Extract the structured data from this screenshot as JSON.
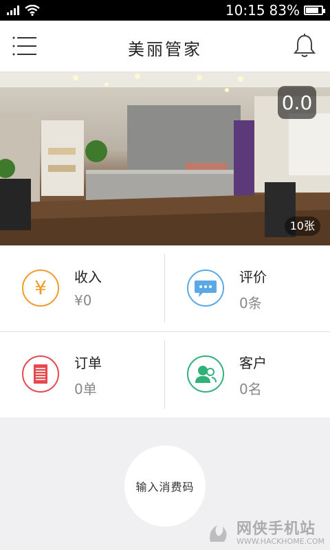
{
  "status_bar": {
    "time": "10:15",
    "battery": "83%",
    "battery_level": 0.83
  },
  "header": {
    "title": "美丽管家"
  },
  "banner": {
    "rating": "0.0",
    "photo_count": "10张"
  },
  "stats": {
    "income": {
      "label": "收入",
      "value": "¥0",
      "symbol": "¥",
      "color": "#f39a2b"
    },
    "review": {
      "label": "评价",
      "value": "0条",
      "color": "#5aa9e6"
    },
    "order": {
      "label": "订单",
      "value": "0单",
      "color": "#e5484d"
    },
    "customer": {
      "label": "客户",
      "value": "0名",
      "color": "#2fb17a"
    }
  },
  "action": {
    "code_button": "输入消费码"
  },
  "watermark": {
    "name": "网侠手机站",
    "url": "WWW.HACKHOME.COM"
  }
}
